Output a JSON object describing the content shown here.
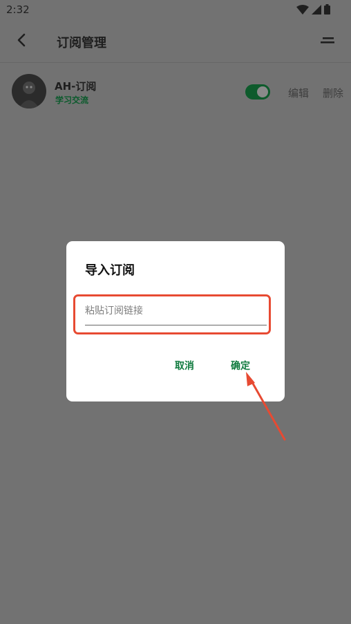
{
  "status": {
    "time": "2:32"
  },
  "appbar": {
    "title": "订阅管理"
  },
  "subscription": {
    "name": "AH-订阅",
    "category": "学习交流",
    "enabled": true,
    "edit_label": "编辑",
    "delete_label": "删除"
  },
  "dialog": {
    "title": "导入订阅",
    "placeholder": "粘贴订阅链接",
    "value": "",
    "cancel_label": "取消",
    "confirm_label": "确定"
  },
  "colors": {
    "accent": "#0f7a3e",
    "highlight": "#e74a32",
    "scrim": "#727272"
  },
  "icons": {
    "back": "back-arrow-icon",
    "menu": "sort-menu-icon",
    "wifi": "wifi-icon",
    "signal": "signal-icon",
    "battery": "battery-icon"
  }
}
